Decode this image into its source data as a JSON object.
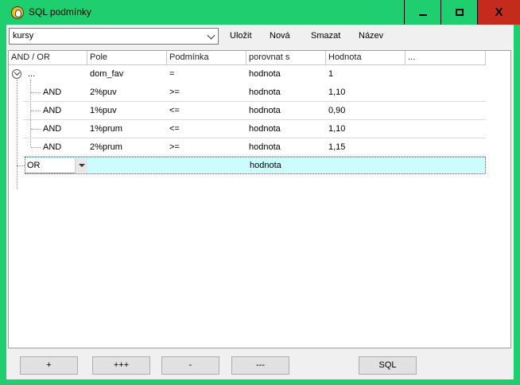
{
  "window": {
    "title": "SQL podmínky",
    "minimize_icon": "minimize-icon",
    "maximize_icon": "maximize-icon",
    "close_glyph": "X"
  },
  "toolbar": {
    "combo_value": "kursy",
    "save_label": "Uložit",
    "new_label": "Nová",
    "delete_label": "Smazat",
    "name_label": "Název"
  },
  "grid": {
    "columns": [
      "AND / OR",
      "Pole",
      "Podmínka",
      "porovnat s",
      "Hodnota",
      "..."
    ],
    "root_row": {
      "andor": "...",
      "field": "dom_fav",
      "cond": "=",
      "compare": "hodnota",
      "value": "1"
    },
    "rows": [
      {
        "andor": "AND",
        "field": "2%puv",
        "cond": ">=",
        "compare": "hodnota",
        "value": "1,10"
      },
      {
        "andor": "AND",
        "field": "1%puv",
        "cond": "<=",
        "compare": "hodnota",
        "value": "0,90"
      },
      {
        "andor": "AND",
        "field": "1%prum",
        "cond": "<=",
        "compare": "hodnota",
        "value": "1,10"
      },
      {
        "andor": "AND",
        "field": "2%prum",
        "cond": ">=",
        "compare": "hodnota",
        "value": "1,15"
      }
    ],
    "edit_row": {
      "andor": "OR",
      "compare": "hodnota"
    }
  },
  "buttons": {
    "add": "+",
    "add_group": "+++",
    "remove": "-",
    "remove_group": "---",
    "sql": "SQL"
  }
}
